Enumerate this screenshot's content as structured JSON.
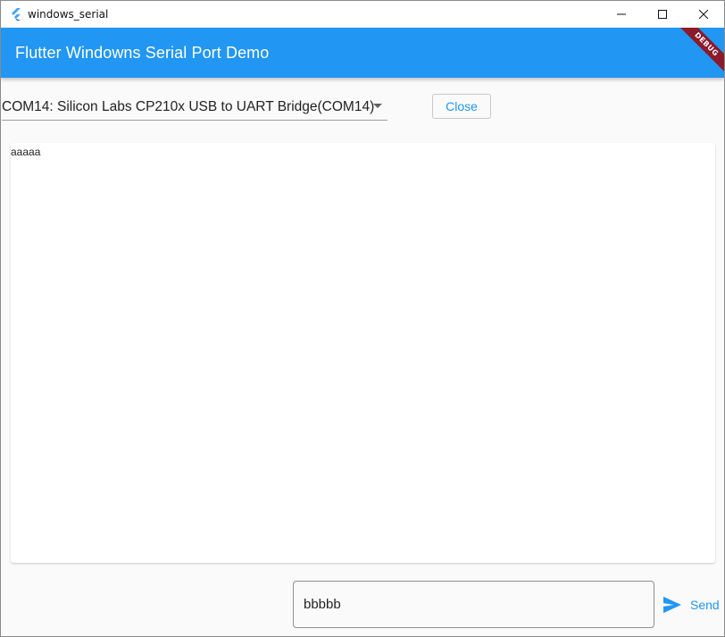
{
  "window": {
    "title": "windows_serial"
  },
  "appbar": {
    "title": "Flutter Windowns Serial Port Demo",
    "debug_label": "DEBUG",
    "color": "#2196F3",
    "banner_color": "#8B1A2B"
  },
  "port_selector": {
    "selected": "COM14: Silicon Labs CP210x USB to UART Bridge(COM14)"
  },
  "close_button": {
    "label": "Close"
  },
  "log": {
    "text": "aaaaa"
  },
  "send": {
    "input_value": "bbbbb",
    "button_label": "Send"
  },
  "icons": {
    "app": "flutter-logo-icon",
    "minimize": "minimize-icon",
    "maximize": "maximize-icon",
    "close": "close-icon",
    "dropdown": "caret-down-icon",
    "send": "send-icon"
  }
}
